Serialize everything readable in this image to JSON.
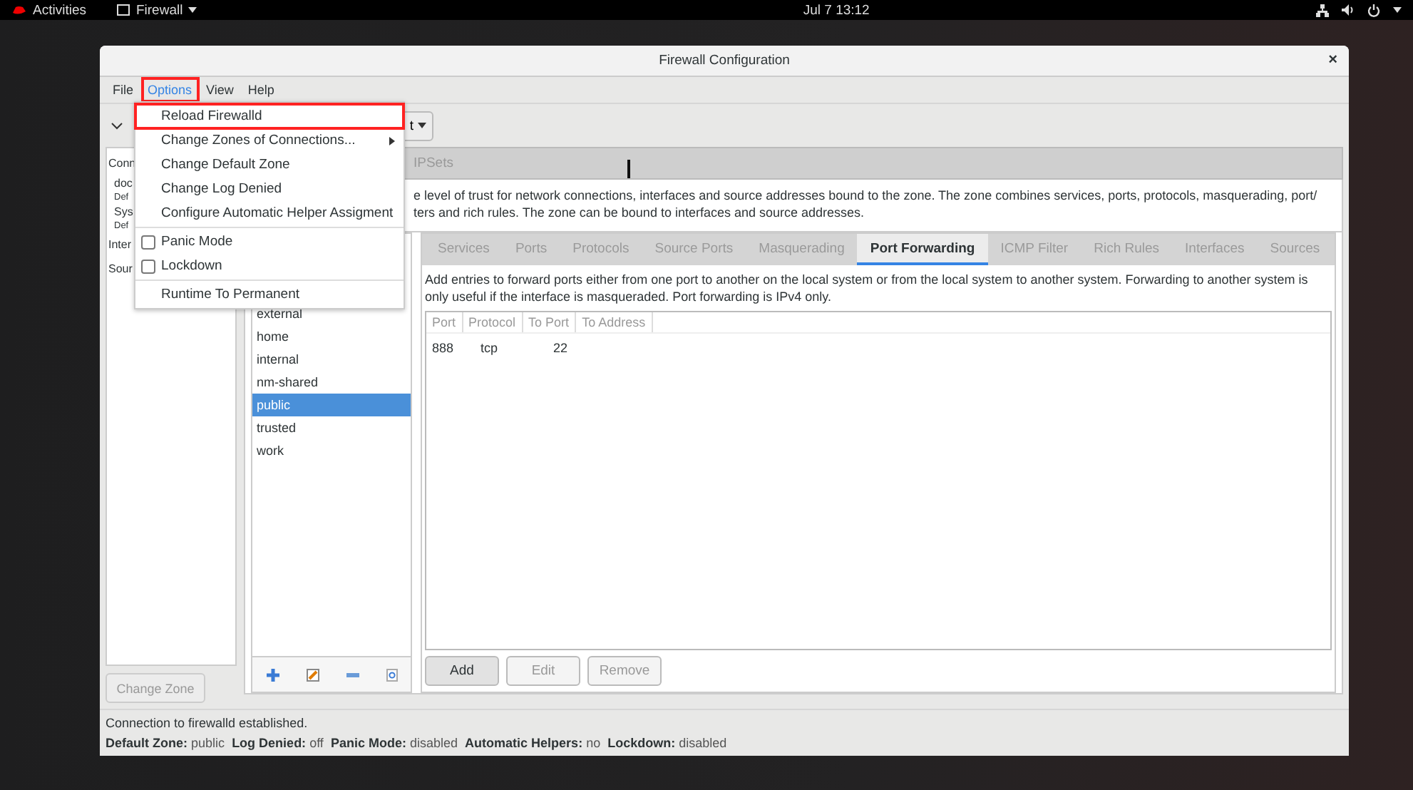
{
  "top_bar": {
    "activities": "Activities",
    "app_menu": "Firewall",
    "clock": "Jul 7  13:12"
  },
  "window": {
    "title": "Firewall Configuration",
    "close": "×"
  },
  "menubar": [
    {
      "label": "File",
      "selected": false,
      "highlighted": false
    },
    {
      "label": "Options",
      "selected": true,
      "highlighted": true
    },
    {
      "label": "View",
      "selected": false,
      "highlighted": false
    },
    {
      "label": "Help",
      "selected": false,
      "highlighted": false
    }
  ],
  "toolbar": {
    "mode_button_partial": "t"
  },
  "options_menu": [
    {
      "kind": "item",
      "label": "Reload Firewalld",
      "highlighted": true
    },
    {
      "kind": "submenu",
      "label": "Change Zones of Connections...",
      "highlighted": false
    },
    {
      "kind": "item",
      "label": "Change Default Zone",
      "highlighted": false
    },
    {
      "kind": "item",
      "label": "Change Log Denied",
      "highlighted": false
    },
    {
      "kind": "item",
      "label": "Configure Automatic Helper Assigment",
      "highlighted": false
    },
    {
      "kind": "separator"
    },
    {
      "kind": "check",
      "label": "Panic Mode",
      "checked": false
    },
    {
      "kind": "check",
      "label": "Lockdown",
      "checked": false
    },
    {
      "kind": "separator"
    },
    {
      "kind": "item",
      "label": "Runtime To Permanent",
      "highlighted": false
    }
  ],
  "left_panel": {
    "items": [
      {
        "kind": "heading",
        "text": "Conn"
      },
      {
        "kind": "name",
        "text": "doc"
      },
      {
        "kind": "sub",
        "text": "Def"
      },
      {
        "kind": "name",
        "text": "Sys"
      },
      {
        "kind": "sub",
        "text": "Def"
      },
      {
        "kind": "heading",
        "text": "Inter"
      },
      {
        "kind": "heading",
        "text": "Sour"
      }
    ],
    "button": "Change Zone"
  },
  "section_tabs": [
    {
      "label": "IPSets"
    }
  ],
  "zone_description": [
    "e level of trust for network connections, interfaces and source addresses bound to the zone. The zone combines services, ports, protocols, masquerading, port/",
    "ters and rich rules. The zone can be bound to interfaces and source addresses."
  ],
  "zones": [
    {
      "name": "external",
      "selected": false
    },
    {
      "name": "home",
      "selected": false
    },
    {
      "name": "internal",
      "selected": false
    },
    {
      "name": "nm-shared",
      "selected": false
    },
    {
      "name": "public",
      "selected": true
    },
    {
      "name": "trusted",
      "selected": false
    },
    {
      "name": "work",
      "selected": false
    }
  ],
  "tabs": [
    {
      "label": "Services",
      "selected": false
    },
    {
      "label": "Ports",
      "selected": false
    },
    {
      "label": "Protocols",
      "selected": false
    },
    {
      "label": "Source Ports",
      "selected": false
    },
    {
      "label": "Masquerading",
      "selected": false
    },
    {
      "label": "Port Forwarding",
      "selected": true
    },
    {
      "label": "ICMP Filter",
      "selected": false
    },
    {
      "label": "Rich Rules",
      "selected": false
    },
    {
      "label": "Interfaces",
      "selected": false
    },
    {
      "label": "Sources",
      "selected": false
    }
  ],
  "port_forwarding": {
    "description": "Add entries to forward ports either from one port to another on the local system or from the local system to another system. Forwarding to another system is only useful if the interface is masqueraded. Port forwarding is IPv4 only.",
    "columns": [
      "Port",
      "Protocol",
      "To Port",
      "To Address"
    ],
    "rows": [
      {
        "port": "888",
        "protocol": "tcp",
        "to_port": "22"
      }
    ],
    "buttons": [
      {
        "label": "Add",
        "disabled": false
      },
      {
        "label": "Edit",
        "disabled": true
      },
      {
        "label": "Remove",
        "disabled": true
      }
    ]
  },
  "status": {
    "message": "Connection to firewalld established.",
    "fields": [
      {
        "label": "Default Zone:",
        "value": "public"
      },
      {
        "label": "Log Denied:",
        "value": "off"
      },
      {
        "label": "Panic Mode:",
        "value": "disabled"
      },
      {
        "label": "Automatic Helpers:",
        "value": "no"
      },
      {
        "label": "Lockdown:",
        "value": "disabled"
      }
    ]
  }
}
